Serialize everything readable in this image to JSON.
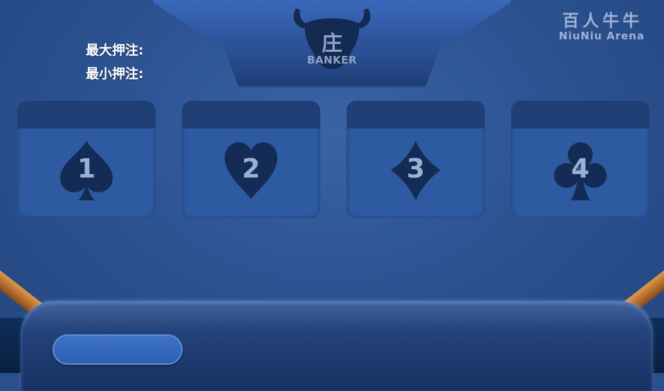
{
  "banker": {
    "label_cn": "庄",
    "label_en": "BANKER",
    "icon": "bull-head-icon"
  },
  "brand": {
    "name_cn": "百人牛牛",
    "name_en": "NiuNiu Arena"
  },
  "bets": {
    "max_label": "最大押注:",
    "min_label": "最小押注:"
  },
  "seats": [
    {
      "number": "1",
      "suit": "spade-icon"
    },
    {
      "number": "2",
      "suit": "heart-icon"
    },
    {
      "number": "3",
      "suit": "diamond-icon"
    },
    {
      "number": "4",
      "suit": "club-icon"
    }
  ],
  "colors": {
    "table": "#2d5393",
    "suit_fill": "#142b55",
    "seat_number": "#9ab0d4",
    "rail": "#c97a34"
  }
}
